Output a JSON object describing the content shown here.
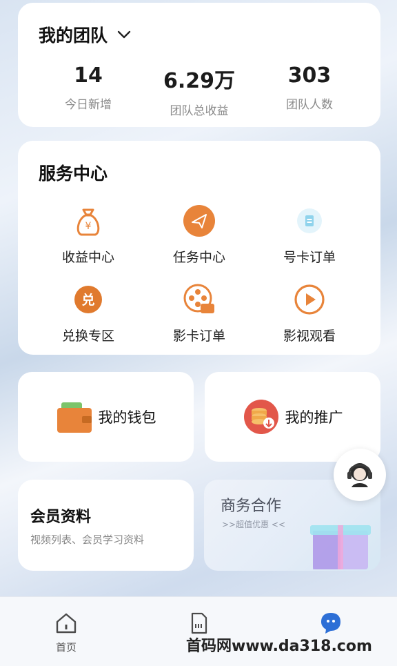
{
  "team": {
    "title": "我的团队",
    "stats": [
      {
        "value": "14",
        "label": "今日新增"
      },
      {
        "value": "6.29万",
        "label": "团队总收益"
      },
      {
        "value": "303",
        "label": "团队人数"
      }
    ]
  },
  "service": {
    "title": "服务中心",
    "items": [
      {
        "label": "收益中心",
        "icon": "money-bag-icon"
      },
      {
        "label": "任务中心",
        "icon": "paper-plane-icon"
      },
      {
        "label": "号卡订单",
        "icon": "sim-card-icon"
      },
      {
        "label": "兑换专区",
        "icon": "exchange-icon"
      },
      {
        "label": "影卡订单",
        "icon": "film-reel-icon"
      },
      {
        "label": "影视观看",
        "icon": "play-icon"
      }
    ]
  },
  "wallet": {
    "label": "我的钱包"
  },
  "promo": {
    "label": "我的推广"
  },
  "member": {
    "title": "会员资料",
    "subtitle": "视频列表、会员学习资料"
  },
  "business": {
    "title": "商务合作",
    "subtitle": ">>超值优惠 <<"
  },
  "nav": {
    "items": [
      {
        "label": "首页",
        "icon": "home-icon"
      },
      {
        "label": "",
        "icon": "sim-card-icon"
      },
      {
        "label": "",
        "icon": "chat-icon"
      }
    ]
  },
  "watermark": "首码网www.da318.com",
  "colors": {
    "accent": "#e8843a",
    "nav_active": "#2d6fd6"
  }
}
